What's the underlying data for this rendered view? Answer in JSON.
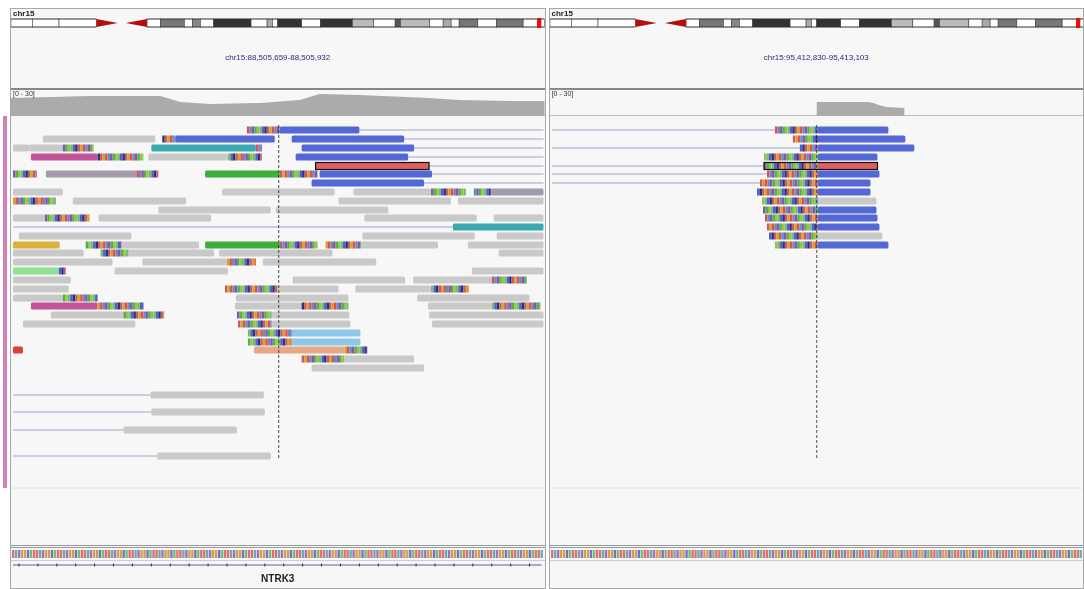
{
  "panels": [
    {
      "chromosome": "chr15",
      "locus": "chr15:88,505,659-88,505,932",
      "coverage_range": "[0 - 30]",
      "gene": "NTRK3"
    },
    {
      "chromosome": "chr15",
      "locus": "chr15:95,412,830-95,413,103",
      "coverage_range": "[0 - 30]"
    }
  ]
}
